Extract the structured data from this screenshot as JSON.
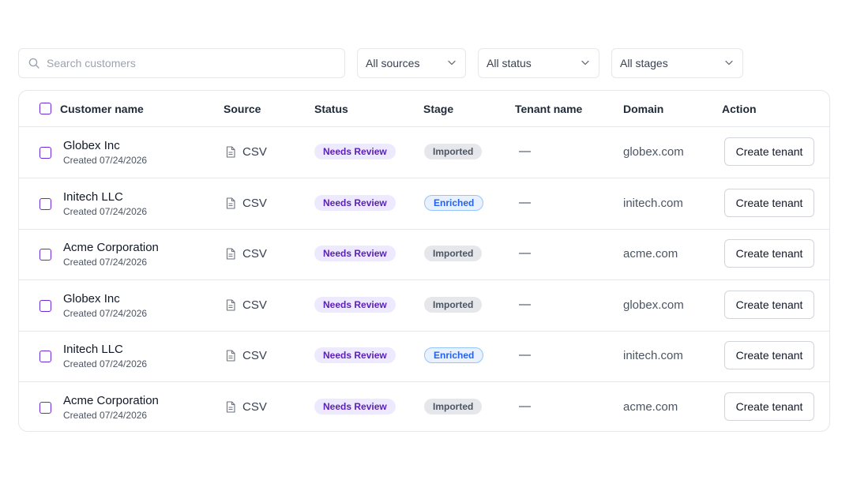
{
  "filters": {
    "search_placeholder": "Search customers",
    "search_value": "",
    "sources_selected": "All sources",
    "status_selected": "All status",
    "stages_selected": "All stages"
  },
  "table": {
    "columns": {
      "customer_name": "Customer name",
      "source": "Source",
      "status": "Status",
      "stage": "Stage",
      "tenant_name": "Tenant name",
      "domain": "Domain",
      "action": "Action"
    },
    "rows": [
      {
        "name": "Globex Inc",
        "created": "Created 07/24/2026",
        "source": "CSV",
        "status": "Needs Review",
        "stage": "Imported",
        "tenant": "—",
        "domain": "globex.com",
        "action": "Create tenant"
      },
      {
        "name": "Initech LLC",
        "created": "Created 07/24/2026",
        "source": "CSV",
        "status": "Needs Review",
        "stage": "Enriched",
        "tenant": "—",
        "domain": "initech.com",
        "action": "Create tenant"
      },
      {
        "name": "Acme Corporation",
        "created": "Created 07/24/2026",
        "source": "CSV",
        "status": "Needs Review",
        "stage": "Imported",
        "tenant": "—",
        "domain": "acme.com",
        "action": "Create tenant"
      },
      {
        "name": "Globex Inc",
        "created": "Created 07/24/2026",
        "source": "CSV",
        "status": "Needs Review",
        "stage": "Imported",
        "tenant": "—",
        "domain": "globex.com",
        "action": "Create tenant"
      },
      {
        "name": "Initech LLC",
        "created": "Created 07/24/2026",
        "source": "CSV",
        "status": "Needs Review",
        "stage": "Enriched",
        "tenant": "—",
        "domain": "initech.com",
        "action": "Create tenant"
      },
      {
        "name": "Acme Corporation",
        "created": "Created 07/24/2026",
        "source": "CSV",
        "status": "Needs Review",
        "stage": "Imported",
        "tenant": "—",
        "domain": "acme.com",
        "action": "Create tenant"
      }
    ]
  },
  "icons": {
    "search": "search-icon",
    "chevron": "chevron-down-icon",
    "source_file": "file-icon"
  },
  "colors": {
    "accent": "#6d28d9",
    "status_needs_review_bg": "#ede9fe",
    "status_needs_review_text": "#5b21b6",
    "stage_imported_bg": "#e5e7eb",
    "stage_enriched_bg": "#e8f1fd",
    "stage_enriched_text": "#2563eb"
  }
}
